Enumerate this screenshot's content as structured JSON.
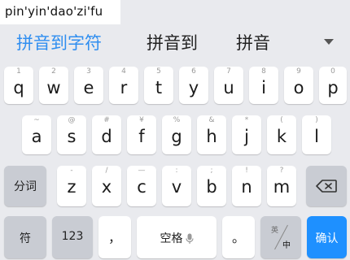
{
  "composition": {
    "text": "pin'yin'dao'zi'fu"
  },
  "candidates": [
    {
      "text": "拼音到字符",
      "selected": true
    },
    {
      "text": "拼音到",
      "selected": false
    },
    {
      "text": "拼音",
      "selected": false
    }
  ],
  "candidate_expand_icon": "chevron-down-icon",
  "rows": {
    "row1": [
      {
        "letter": "q",
        "hint": "1"
      },
      {
        "letter": "w",
        "hint": "2"
      },
      {
        "letter": "e",
        "hint": "3"
      },
      {
        "letter": "r",
        "hint": "4"
      },
      {
        "letter": "t",
        "hint": "5"
      },
      {
        "letter": "y",
        "hint": "6"
      },
      {
        "letter": "u",
        "hint": "7"
      },
      {
        "letter": "i",
        "hint": "8"
      },
      {
        "letter": "o",
        "hint": "9"
      },
      {
        "letter": "p",
        "hint": "0"
      }
    ],
    "row2": [
      {
        "letter": "a",
        "hint": "~"
      },
      {
        "letter": "s",
        "hint": "@"
      },
      {
        "letter": "d",
        "hint": "#"
      },
      {
        "letter": "f",
        "hint": "¥"
      },
      {
        "letter": "g",
        "hint": "%"
      },
      {
        "letter": "h",
        "hint": "&"
      },
      {
        "letter": "j",
        "hint": "*"
      },
      {
        "letter": "k",
        "hint": "("
      },
      {
        "letter": "l",
        "hint": ")"
      }
    ],
    "row3": [
      {
        "letter": "z",
        "hint": "-"
      },
      {
        "letter": "x",
        "hint": "/"
      },
      {
        "letter": "c",
        "hint": "—"
      },
      {
        "letter": "v",
        "hint": ":"
      },
      {
        "letter": "b",
        "hint": ";"
      },
      {
        "letter": "n",
        "hint": "!"
      },
      {
        "letter": "m",
        "hint": "?"
      }
    ]
  },
  "keys": {
    "segment_label": "分词",
    "symbol_label": "符",
    "numbers_label": "123",
    "comma_label": "，",
    "space_label": "空格",
    "period_label": "。",
    "lang_en_label": "英",
    "lang_zh_label": "中",
    "confirm_label": "确认",
    "backspace_icon": "backspace-icon",
    "mic_icon": "microphone-icon"
  },
  "colors": {
    "accent": "#2f8ef0",
    "confirm_bg": "#1e90ff",
    "keyboard_bg": "#e9eaee",
    "function_key_bg": "#c9ccd3"
  }
}
